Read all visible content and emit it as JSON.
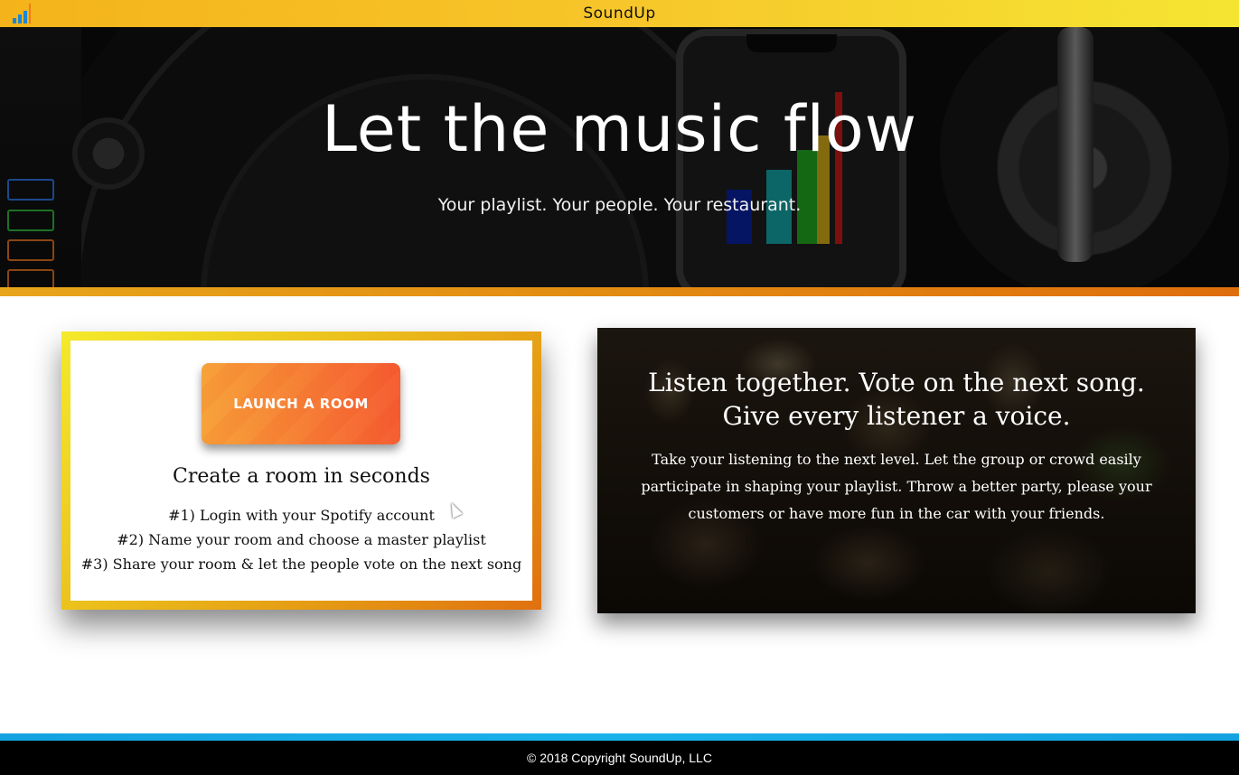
{
  "header": {
    "brand": "SoundUp",
    "logo_icon": "bar-chart-logo-icon",
    "logo_colors": [
      "#1b86d6",
      "#f47a1a"
    ]
  },
  "hero": {
    "title": "Let the music flow",
    "tagline": "Your playlist. Your people. Your restaurant.",
    "background": "turntable-and-phone-photo",
    "bar_colors": [
      "#0a1f9a",
      "#139d9e",
      "#1fa01f",
      "#c9a316",
      "#c21818"
    ]
  },
  "launch_card": {
    "button_label": "LAUNCH A ROOM",
    "heading": "Create a room in seconds",
    "steps": [
      "#1) Login with your Spotify account",
      "#2) Name your room and choose a master playlist",
      "#3) Share your room & let the people vote on the next song"
    ]
  },
  "promo_card": {
    "background": "crowd-photo",
    "heading": "Listen together. Vote on the next song. Give every listener a voice.",
    "body": "Take your listening to the next level. Let the group or crowd easily participate in shaping your playlist. Throw a better party, please your customers or have more fun in the car with your friends."
  },
  "footer": {
    "copyright": "© 2018 Copyright SoundUp, LLC"
  },
  "colors": {
    "accent_yellow": "#f5e532",
    "accent_orange": "#e07010",
    "footer_blue": "#14a2e0"
  }
}
